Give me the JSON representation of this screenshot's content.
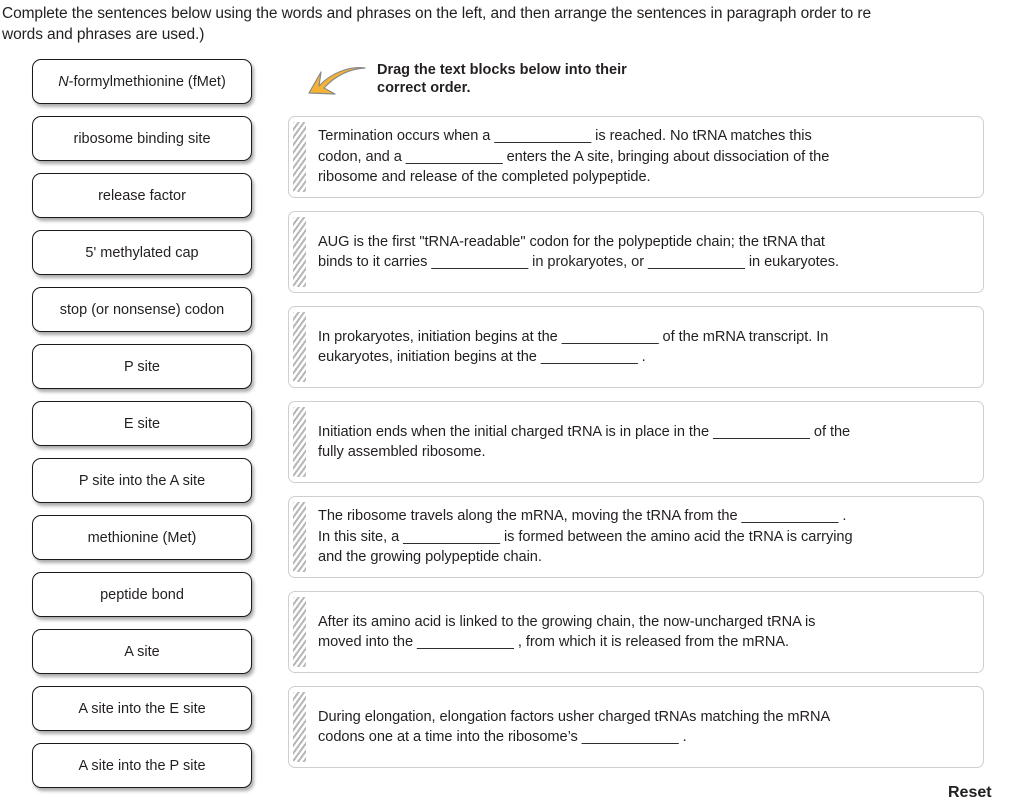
{
  "header": {
    "instruction": "Complete the sentences below using the words and phrases on the left, and then arrange the sentences in paragraph order to re\nwords and phrases are used.)"
  },
  "callout": {
    "arrow_icon": "curved-arrow-down-left-icon",
    "arrow_color": "#F5B battle",
    "label": "Drag the text blocks below into their\ncorrect order."
  },
  "wordbank": {
    "items": [
      {
        "prefix_italic": "N",
        "label": "-formylmethionine (fMet)"
      },
      {
        "prefix_italic": "",
        "label": "ribosome binding site"
      },
      {
        "prefix_italic": "",
        "label": "release factor"
      },
      {
        "prefix_italic": "",
        "label": "5' methylated cap"
      },
      {
        "prefix_italic": "",
        "label": "stop (or nonsense) codon"
      },
      {
        "prefix_italic": "",
        "label": "P site"
      },
      {
        "prefix_italic": "",
        "label": "E site"
      },
      {
        "prefix_italic": "",
        "label": "P site into the A site"
      },
      {
        "prefix_italic": "",
        "label": "methionine (Met)"
      },
      {
        "prefix_italic": "",
        "label": "peptide bond"
      },
      {
        "prefix_italic": "",
        "label": "A site"
      },
      {
        "prefix_italic": "",
        "label": "A site into the E site"
      },
      {
        "prefix_italic": "",
        "label": "A site into the P site"
      }
    ]
  },
  "blocks": [
    {
      "text": "Termination occurs when a  ____________  is reached. No tRNA matches this\ncodon, and a  ____________  enters the A site, bringing about dissociation of the\nribosome and release of the completed polypeptide."
    },
    {
      "text": "AUG is the first \"tRNA-readable\" codon for the polypeptide chain; the tRNA that\nbinds to it carries  ____________  in prokaryotes, or  ____________  in eukaryotes."
    },
    {
      "text": "In prokaryotes, initiation begins at the  ____________  of the mRNA transcript. In\neukaryotes, initiation begins at the  ____________ ."
    },
    {
      "text": "Initiation ends when the initial charged tRNA is in place in the  ____________  of the\nfully assembled ribosome."
    },
    {
      "text": "The ribosome travels along the mRNA, moving the tRNA from the  ____________ .\nIn this site, a  ____________  is formed between the amino acid the tRNA is carrying\nand the growing polypeptide chain."
    },
    {
      "text": "After its amino acid is linked to the growing chain, the now-uncharged tRNA is\nmoved into the  ____________ , from which it is released from the mRNA."
    },
    {
      "text": "During elongation, elongation factors usher charged tRNAs matching the mRNA\ncodons one at a time into the ribosome’s  ____________ ."
    }
  ],
  "footer": {
    "reset_label": "Reset"
  }
}
